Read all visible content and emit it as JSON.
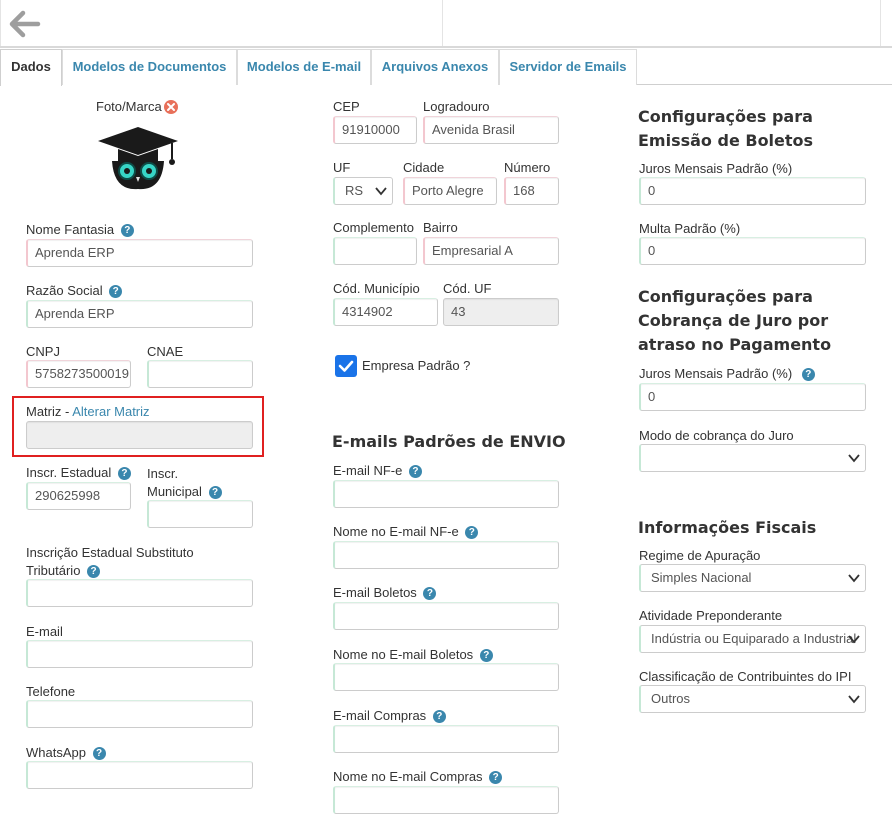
{
  "tabs": [
    {
      "label": "Dados",
      "active": true
    },
    {
      "label": "Modelos de Documentos",
      "active": false
    },
    {
      "label": "Modelos de E-mail",
      "active": false
    },
    {
      "label": "Arquivos Anexos",
      "active": false
    },
    {
      "label": "Servidor de Emails",
      "active": false
    }
  ],
  "left": {
    "foto_label": "Foto/Marca",
    "nome_fantasia": {
      "label": "Nome Fantasia",
      "value": "Aprenda ERP"
    },
    "razao_social": {
      "label": "Razão Social",
      "value": "Aprenda ERP"
    },
    "cnpj": {
      "label": "CNPJ",
      "value": "5758273500019"
    },
    "cnae": {
      "label": "CNAE",
      "value": ""
    },
    "matriz": {
      "label": "Matriz - ",
      "link": "Alterar Matriz",
      "value": ""
    },
    "inscr_estadual": {
      "label": "Inscr. Estadual",
      "value": "290625998"
    },
    "inscr_municipal": {
      "label_line1": "Inscr.",
      "label_line2": "Municipal",
      "value": ""
    },
    "ie_st": {
      "label_line1": "Inscrição Estadual Substituto",
      "label_line2": "Tributário",
      "value": ""
    },
    "email": {
      "label": "E-mail",
      "value": ""
    },
    "telefone": {
      "label": "Telefone",
      "value": ""
    },
    "whatsapp": {
      "label": "WhatsApp",
      "value": ""
    }
  },
  "middle": {
    "cep": {
      "label": "CEP",
      "value": "91910000"
    },
    "logradouro": {
      "label": "Logradouro",
      "value": "Avenida Brasil"
    },
    "uf": {
      "label": "UF",
      "value": "RS"
    },
    "cidade": {
      "label": "Cidade",
      "value": "Porto Alegre"
    },
    "numero": {
      "label": "Número",
      "value": "168"
    },
    "complemento": {
      "label": "Complemento",
      "value": ""
    },
    "bairro": {
      "label": "Bairro",
      "value": "Empresarial A"
    },
    "cod_municipio": {
      "label": "Cód. Município",
      "value": "4314902"
    },
    "cod_uf": {
      "label": "Cód. UF",
      "value": "43"
    },
    "empresa_padrao": {
      "label": "Empresa Padrão ?",
      "checked": true
    },
    "emails_title": "E-mails Padrões de ENVIO",
    "email_nfe": {
      "label": "E-mail NF-e",
      "value": ""
    },
    "nome_email_nfe": {
      "label": "Nome no E-mail NF-e",
      "value": ""
    },
    "email_boletos": {
      "label": "E-mail Boletos",
      "value": ""
    },
    "nome_email_boletos": {
      "label": "Nome no E-mail Boletos",
      "value": ""
    },
    "email_compras": {
      "label": "E-mail Compras",
      "value": ""
    },
    "nome_email_compras": {
      "label": "Nome no E-mail Compras",
      "value": ""
    }
  },
  "right": {
    "boletos_title_line1": "Configurações para",
    "boletos_title_line2": "Emissão de Boletos",
    "juros_mensais": {
      "label": "Juros Mensais Padrão (%)",
      "value": "0"
    },
    "multa": {
      "label": "Multa Padrão (%)",
      "value": "0"
    },
    "cobranca_title_line1": "Configurações para",
    "cobranca_title_line2": "Cobrança de Juro por",
    "cobranca_title_line3": "atraso no Pagamento",
    "juros_mensais_2": {
      "label": "Juros Mensais Padrão (%)",
      "value": "0"
    },
    "modo_cobranca": {
      "label": "Modo de cobrança do Juro",
      "value": ""
    },
    "fiscais_title": "Informações Fiscais",
    "regime": {
      "label": "Regime de Apuração",
      "value": "Simples Nacional"
    },
    "atividade": {
      "label": "Atividade Preponderante",
      "value": "Indústria ou Equiparado a Industrial"
    },
    "classificacao": {
      "label": "Classificação de Contribuintes do IPI",
      "value": "Outros"
    }
  },
  "colors": {
    "accent": "#3a87ad",
    "highlight_border": "#e02020",
    "checkbox": "#1a73e8"
  },
  "icons": {
    "back": "arrow-left-icon",
    "remove_photo": "close-circle-icon",
    "logo": "graduation-cap-owl-logo",
    "help": "question-circle-icon"
  }
}
